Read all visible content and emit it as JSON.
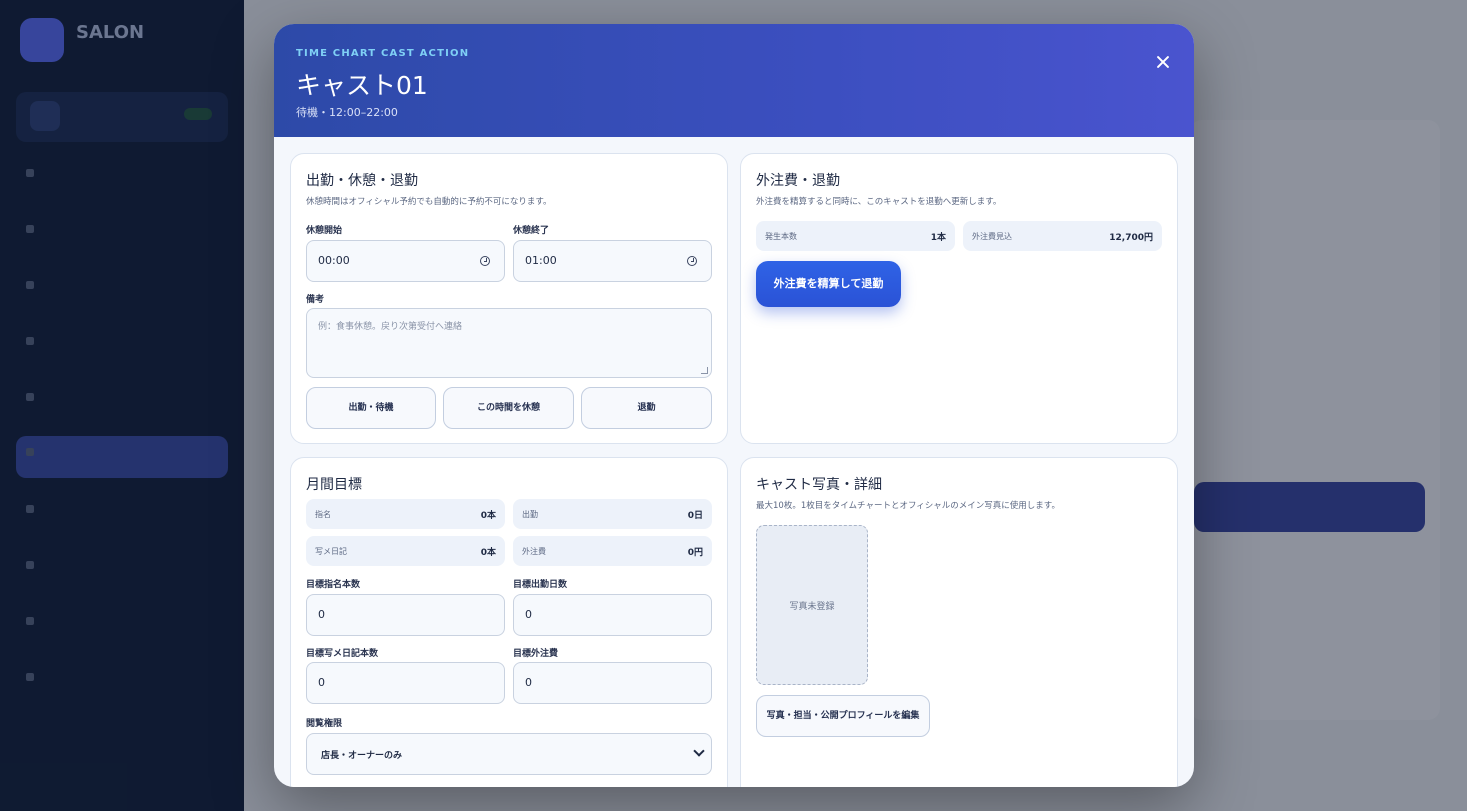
{
  "background": {
    "brand": "SALON",
    "brand_sub": "",
    "store_label": "",
    "store_name": "",
    "nav_items": [
      {
        "label": ""
      },
      {
        "label": ""
      },
      {
        "label": ""
      },
      {
        "label": ""
      },
      {
        "label": ""
      },
      {
        "label": ""
      },
      {
        "label": ""
      },
      {
        "label": ""
      },
      {
        "label": ""
      },
      {
        "label": ""
      }
    ]
  },
  "modal": {
    "eyebrow": "TIME CHART CAST ACTION",
    "cast_name": "キャスト01",
    "cast_sub": "待機・12:00–22:00",
    "close_icon": "close-icon"
  },
  "attendance": {
    "title": "出勤・休憩・退勤",
    "desc": "休憩時間はオフィシャル予約でも自動的に予約不可になります。",
    "break_start_label": "休憩開始",
    "break_start_value": "00:00",
    "break_end_label": "休憩終了",
    "break_end_value": "01:00",
    "note_label": "備考",
    "note_placeholder": "例：食事休憩。戻り次第受付へ連絡",
    "btn_clock_in": "出勤・待機",
    "btn_break": "この時間を休憩",
    "btn_clock_out": "退勤"
  },
  "outsourcing": {
    "title": "外注費・退勤",
    "desc": "外注費を精算すると同時に、このキャストを退勤へ更新します。",
    "count_label": "発生本数",
    "count_value": "1本",
    "fee_label": "外注費見込",
    "fee_value": "12,700円",
    "settle_button": "外注費を精算して退勤"
  },
  "monthly": {
    "title": "月間目標",
    "stats": [
      {
        "label": "指名",
        "value": "0本"
      },
      {
        "label": "出勤",
        "value": "0日"
      },
      {
        "label": "写メ日記",
        "value": "0本"
      },
      {
        "label": "外注費",
        "value": "0円"
      }
    ],
    "target_nomination_label": "目標指名本数",
    "target_nomination_value": "0",
    "target_days_label": "目標出勤日数",
    "target_days_value": "0",
    "target_diary_label": "目標写メ日記本数",
    "target_diary_value": "0",
    "target_fee_label": "目標外注費",
    "target_fee_value": "0",
    "permission_label": "閲覧権限",
    "permission_value": "店長・オーナーのみ"
  },
  "photo": {
    "title": "キャスト写真・詳細",
    "desc": "最大10枚。1枚目をタイムチャートとオフィシャルのメイン写真に使用します。",
    "slot_placeholder": "写真未登録",
    "edit_button": "写真・担当・公開プロフィールを編集"
  },
  "colors": {
    "header_start": "#2d4aa8",
    "header_end": "#4a54cf",
    "primary_button": "#2f63e6",
    "eyebrow": "#7fd0f5"
  }
}
